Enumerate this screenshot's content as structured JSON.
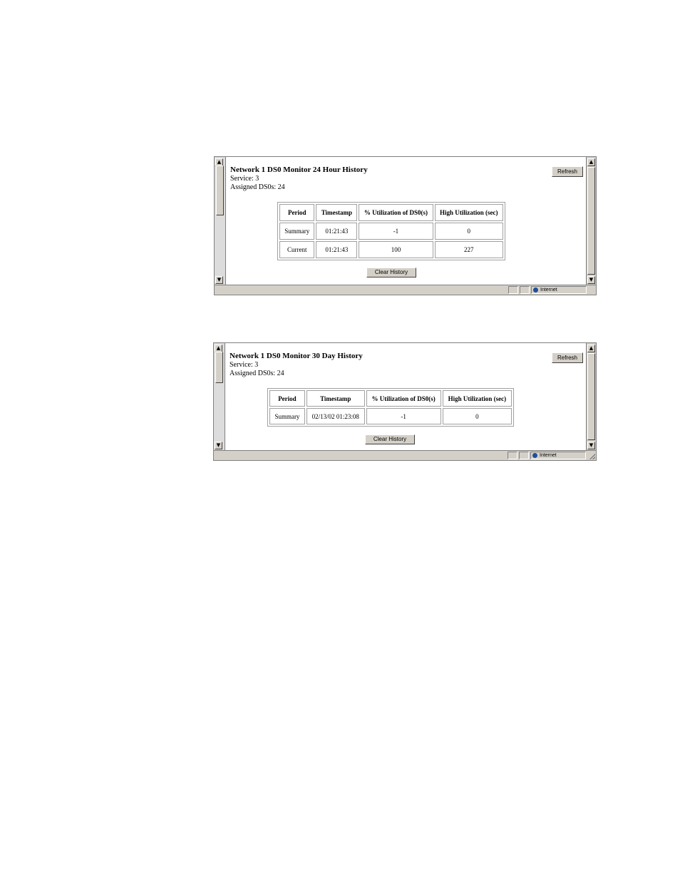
{
  "windows": [
    {
      "title": "Network 1 DS0 Monitor 24 Hour History",
      "service": "Service: 3",
      "assigned": "Assigned DS0s: 24",
      "refresh_label": "Refresh",
      "columns": [
        "Period",
        "Timestamp",
        "% Utilization of DS0(s)",
        "High Utilization (sec)"
      ],
      "rows": [
        [
          "Summary",
          "01:21:43",
          "-1",
          "0"
        ],
        [
          "Current",
          "01:21:43",
          "100",
          "227"
        ]
      ],
      "clear_label": "Clear History",
      "status_zone": "Internet"
    },
    {
      "title": "Network 1 DS0 Monitor 30 Day History",
      "service": "Service: 3",
      "assigned": "Assigned DS0s: 24",
      "refresh_label": "Refresh",
      "columns": [
        "Period",
        "Timestamp",
        "% Utilization of DS0(s)",
        "High Utilization (sec)"
      ],
      "rows": [
        [
          "Summary",
          "02/13/02 01:23:08",
          "-1",
          "0"
        ]
      ],
      "clear_label": "Clear History",
      "status_zone": "Internet"
    }
  ]
}
